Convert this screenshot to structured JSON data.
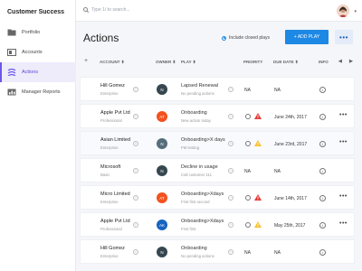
{
  "app": {
    "brand": "Customer Success"
  },
  "sidebar": {
    "items": [
      {
        "label": "Portfolio",
        "icon": "folder-icon",
        "active": false
      },
      {
        "label": "Accounts",
        "icon": "accounts-icon",
        "active": false
      },
      {
        "label": "Actions",
        "icon": "actions-icon",
        "active": true
      },
      {
        "label": "Manager Reports",
        "icon": "reports-icon",
        "active": false
      }
    ]
  },
  "topbar": {
    "search_placeholder": "Type 1/ to search..."
  },
  "page": {
    "title": "Actions",
    "include_closed_label": "Include closed plays",
    "add_play_label": "+ ADD PLAY",
    "more_label": "•••"
  },
  "table": {
    "columns": [
      "+",
      "ACCOUNT ⬍",
      "OWNER ⬍",
      "PLAY ⬍",
      "PRIORITY",
      "DUE DATE ⬍",
      "INFO"
    ],
    "rows": [
      {
        "account": "Hill Gomez",
        "tier": "Enterprise",
        "owner": "N",
        "owner_color": "#37474f",
        "play": "Lapsed Renewal",
        "play_sub": "No pending actions",
        "priority": "NA",
        "priority_icon": "",
        "due": "NA",
        "menu": false
      },
      {
        "account": "Apple Pvt Ltd",
        "tier": "Professional",
        "owner": "AT",
        "owner_color": "#f4511e",
        "play": "Onboarding",
        "play_sub": "New action today",
        "priority": "",
        "priority_icon": "red",
        "due": "June 24th, 2017",
        "menu": true
      },
      {
        "account": "Asian Limited",
        "tier": "Enterprise",
        "owner": "N",
        "owner_color": "#546e7a",
        "play": "Onboarding>X days",
        "play_sub": "FM testing",
        "priority": "",
        "priority_icon": "orange",
        "due": "June 23rd, 2017",
        "menu": true
      },
      {
        "account": "Microsoft",
        "tier": "Basic",
        "owner": "N",
        "owner_color": "#37474f",
        "play": "Decline in usage",
        "play_sub": "Call customer 111",
        "priority": "NA",
        "priority_icon": "",
        "due": "NA",
        "menu": false
      },
      {
        "account": "Micro Limited",
        "tier": "Enterprise",
        "owner": "AT",
        "owner_color": "#f4511e",
        "play": "Onboarding>Xdays",
        "play_sub": "First first second",
        "priority": "",
        "priority_icon": "red",
        "due": "June 14th, 2017",
        "menu": true
      },
      {
        "account": "Apple Pvt Ltd",
        "tier": "Professional",
        "owner": "AK",
        "owner_color": "#1565c0",
        "play": "Onboarding>Xdays",
        "play_sub": "First first",
        "priority": "",
        "priority_icon": "orange",
        "due": "May 25th, 2017",
        "menu": true
      },
      {
        "account": "Hill Gomez",
        "tier": "Enterprise",
        "owner": "N",
        "owner_color": "#37474f",
        "play": "Onboarding",
        "play_sub": "No pending actions",
        "priority": "NA",
        "priority_icon": "",
        "due": "NA",
        "menu": false
      }
    ]
  },
  "colors": {
    "accent": "#1e88e5",
    "sidebar_active": "#6c57e8",
    "warn_red": "#e53935",
    "warn_orange": "#fbc02d"
  }
}
